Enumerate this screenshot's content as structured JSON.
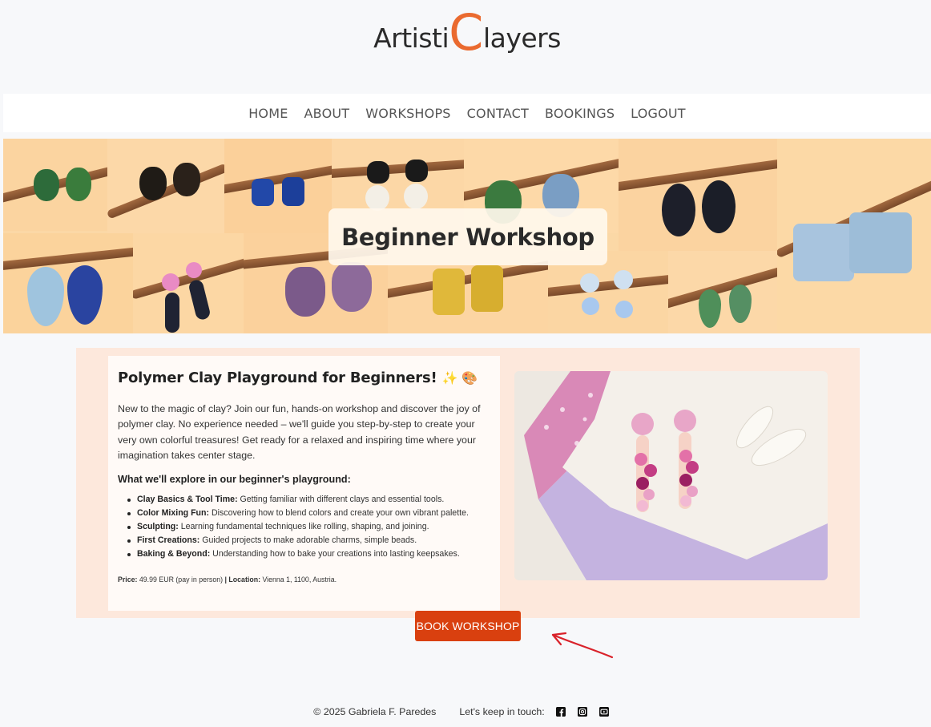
{
  "logo": {
    "prefix": "Artisti",
    "accent_letter": "C",
    "suffix": "layers"
  },
  "nav": {
    "items": [
      "HOME",
      "ABOUT",
      "WORKSHOPS",
      "CONTACT",
      "BOOKINGS",
      "LOGOUT"
    ]
  },
  "hero": {
    "title": "Beginner Workshop"
  },
  "workshop": {
    "heading": "Polymer Clay Playground for Beginners!",
    "heading_emoji": "✨ 🎨",
    "intro": "New to the magic of clay? Join our fun, hands-on workshop and discover the joy of polymer clay. No experience needed – we'll guide you step-by-step to create your very own colorful treasures! Get ready for a relaxed and inspiring time where your imagination takes center stage.",
    "explore_heading": "What we'll explore in our beginner's playground:",
    "topics": [
      {
        "label": "Clay Basics & Tool Time:",
        "text": " Getting familiar with different clays and essential tools."
      },
      {
        "label": "Color Mixing Fun:",
        "text": " Discovering how to blend colors and create your own vibrant palette."
      },
      {
        "label": "Sculpting:",
        "text": " Learning fundamental techniques like rolling, shaping, and joining."
      },
      {
        "label": "First Creations:",
        "text": " Guided projects to make adorable charms, simple beads."
      },
      {
        "label": "Baking & Beyond:",
        "text": " Understanding how to bake your creations into lasting keepsakes."
      }
    ],
    "price_label": "Price:",
    "price_value": " 49.99 EUR (pay in person) ",
    "separator": "|",
    "location_label": " Location:",
    "location_value": " Vienna 1, 1100, Austria."
  },
  "book_button": "BOOK WORKSHOP",
  "footer": {
    "copyright": "© 2025 Gabriela F. Paredes",
    "touch": "Let's keep in touch:",
    "social_icons": [
      "facebook-icon",
      "instagram-icon",
      "youtube-icon"
    ]
  },
  "colors": {
    "accent": "#ea6a2f",
    "button": "#d9400f",
    "panel_bg": "#fde8dc",
    "hero_bg": "#fbd8a6"
  }
}
